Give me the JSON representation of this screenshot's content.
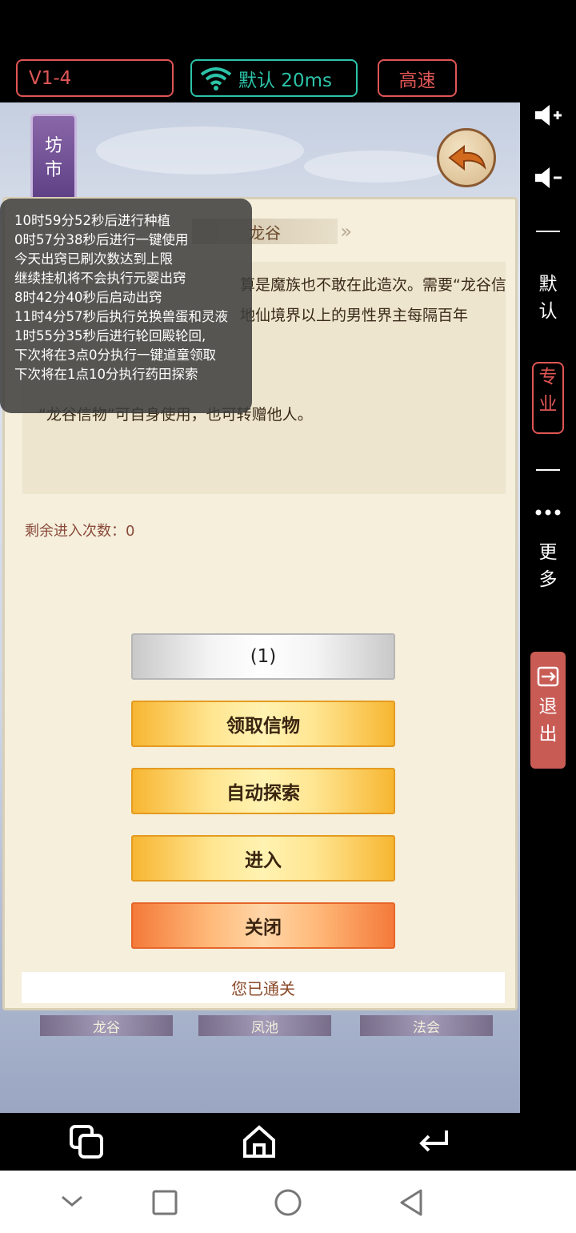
{
  "topbar": {
    "version": "V1-4",
    "network": "默认 20ms",
    "speed": "高速"
  },
  "game": {
    "market_label_1": "坊",
    "market_label_2": "市",
    "panel_title": "龙谷",
    "description": [
      "",
      "算是魔族也不敢在此造次。需要“龙谷信",
      "地仙境界以上的男性界主每隔百年",
      "",
      "“龙谷信物”可自身使用，也可转赠他人。"
    ],
    "remaining": "剩余进入次数：0",
    "buttons": {
      "count": "(1)",
      "claim": "领取信物",
      "auto_explore": "自动探索",
      "enter": "进入",
      "close": "关闭"
    },
    "cleared": "您已通关",
    "bottom_tabs": [
      "龙谷",
      "凤池",
      "法会"
    ]
  },
  "log": [
    "10时59分52秒后进行种植",
    "0时57分38秒后进行一键使用",
    "今天出窍已刷次数达到上限",
    "继续挂机将不会执行元婴出窍",
    "8时42分40秒后启动出窍",
    "11时4分57秒后执行兑换兽蛋和灵液",
    "1时55分35秒后进行轮回殿轮回,",
    "下次将在3点0分执行一键道童领取",
    "下次将在1点10分执行药田探索"
  ],
  "side": {
    "default_1": "默",
    "default_2": "认",
    "pro_1": "专",
    "pro_2": "业",
    "more_1": "更",
    "more_2": "多",
    "exit_1": "退",
    "exit_2": "出"
  },
  "colors": {
    "accent_red": "#e05555",
    "accent_teal": "#2cc3a8",
    "gold": "#ffe590",
    "orange": "#f47a3a"
  }
}
